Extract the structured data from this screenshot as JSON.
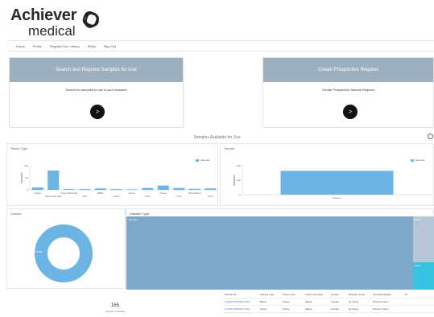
{
  "brand": {
    "line1": "Achiever",
    "line2": "medical"
  },
  "nav": [
    "Home",
    "Profile",
    "Register Run Library",
    "FAQs",
    "Sign Out"
  ],
  "cards": [
    {
      "title": "Search and Request Samples for Use",
      "subtitle": "Search for samples to use in your research",
      "button": ">"
    },
    {
      "title": "Create Prospective Request",
      "subtitle": "Create Prospective Sample Request",
      "button": ">"
    }
  ],
  "section_title": "Samples Available for Use",
  "panels": {
    "tissue_type": "Tissue Type",
    "gender": "Gender",
    "sample": "Sample",
    "disease_type": "Disease Type"
  },
  "legend": {
    "samples": "Samples"
  },
  "treemap": {
    "main": "Disease",
    "right_top": "Other",
    "right_bottom": "Other"
  },
  "donut": {
    "label": "Blood 100%"
  },
  "table": {
    "headers": [
      "Sample ID",
      "Sample Type",
      "Tissue Type",
      "Tissue Cell Type",
      "Gender",
      "Disease Group",
      "Survival Indicator",
      "Ri"
    ],
    "rows": [
      [
        "0-2020-00000001-0001",
        "Blood",
        "Tissue",
        "Saline",
        "Female",
        "No Study",
        "Primary Tumor",
        ""
      ],
      [
        "0-2020-00000001-0002",
        "Serum",
        "Tissue",
        "Saline",
        "Female",
        "No Study",
        "Primary Tumor",
        ""
      ]
    ]
  },
  "summary": {
    "count": "165",
    "label": "Samples Available"
  },
  "chart_data": [
    {
      "type": "bar",
      "title": "Tissue Type",
      "categories": [
        "Ascites",
        "Blood (Parental)",
        "Tissue (Parental)",
        "CSF",
        "PBMC",
        "Saliva",
        "Serum",
        "Stool",
        "Tissue",
        "Urine",
        "Whole Blood",
        "Other"
      ],
      "tick_labels": [
        "Ascites",
        "Blood (Parental)",
        "Tissue (Parental)",
        "CSF",
        "PBMC",
        "Saliva",
        "Serum",
        "Stool",
        "Tissue",
        "Urine",
        "Whole Blood",
        "Other"
      ],
      "series": [
        {
          "name": "Samples",
          "values": [
            10,
            80,
            3,
            3,
            6,
            3,
            2,
            8,
            18,
            8,
            4,
            6
          ]
        }
      ],
      "ylabel": "Samples",
      "ylim": [
        0,
        100
      ],
      "yticks": [
        0,
        50,
        100
      ]
    },
    {
      "type": "bar",
      "title": "Gender",
      "categories": [
        "Unknown"
      ],
      "series": [
        {
          "name": "Samples",
          "values": [
            165
          ]
        }
      ],
      "ylabel": "Samples",
      "ylim": [
        0,
        200
      ],
      "yticks": [
        0,
        100,
        200
      ]
    },
    {
      "type": "pie",
      "title": "Sample",
      "series": [
        {
          "name": "Blood",
          "values": [
            165
          ]
        }
      ],
      "colors": [
        "#6cb4e4"
      ]
    }
  ],
  "colors": {
    "bar": "#6cb4e4",
    "treemap_main": "#7fa7c9",
    "treemap_side": "#b5c7d8",
    "treemap_cyan": "#36c4e0"
  }
}
